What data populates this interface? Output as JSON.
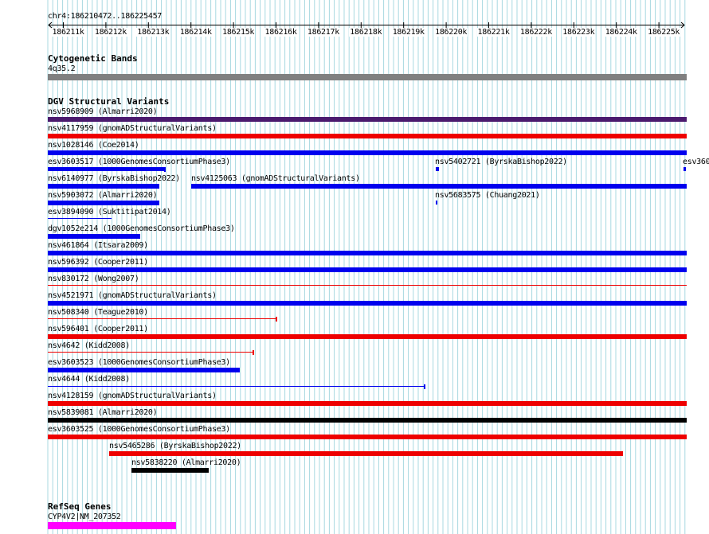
{
  "colors": {
    "grid": "#a8d8e0",
    "blue": "#0000ee",
    "red": "#ee0000",
    "purple": "#4b1a6e",
    "black": "#000000",
    "gray": "#808080",
    "magenta": "#ff00ff"
  },
  "ruler": {
    "location": "chr4:186210472..186225457",
    "ticks": [
      "186211k",
      "186212k",
      "186213k",
      "186214k",
      "186215k",
      "186216k",
      "186217k",
      "186218k",
      "186219k",
      "186220k",
      "186221k",
      "186222k",
      "186223k",
      "186224k",
      "186225k"
    ]
  },
  "cytobands": {
    "title": "Cytogenetic Bands",
    "band": "4q35.2"
  },
  "dgv": {
    "title": "DGV Structural Variants"
  },
  "refseq": {
    "title": "RefSeq Genes",
    "gene": "CYP4V2|NM_207352"
  },
  "features": [
    {
      "label": "nsv5968909 (Almarri2020)",
      "color": "purple"
    },
    {
      "label": "nsv4117959 (gnomADStructuralVariants)",
      "color": "red"
    },
    {
      "label": "nsv1028146 (Coe2014)",
      "color": "blue"
    },
    {
      "label": "esv3603517 (1000GenomesConsortiumPhase3)",
      "color": "blue"
    },
    {
      "label": "nsv5402721 (ByrskaBishop2022)",
      "color": "blue"
    },
    {
      "label": "esv360",
      "color": "blue"
    },
    {
      "label": "nsv6140977 (ByrskaBishop2022)",
      "color": "blue"
    },
    {
      "label": "nsv4125063 (gnomADStructuralVariants)",
      "color": "blue"
    },
    {
      "label": "nsv5903072 (Almarri2020)",
      "color": "blue"
    },
    {
      "label": "nsv5683575 (Chuang2021)",
      "color": "blue"
    },
    {
      "label": "esv3894090 (Suktitipat2014)",
      "color": "blue"
    },
    {
      "label": "dgv1052e214 (1000GenomesConsortiumPhase3)",
      "color": "blue"
    },
    {
      "label": "nsv461864 (Itsara2009)",
      "color": "blue"
    },
    {
      "label": "nsv596392 (Cooper2011)",
      "color": "blue"
    },
    {
      "label": "nsv830172 (Wong2007)",
      "color": "red"
    },
    {
      "label": "nsv4521971 (gnomADStructuralVariants)",
      "color": "blue"
    },
    {
      "label": "nsv508340 (Teague2010)",
      "color": "red"
    },
    {
      "label": "nsv596401 (Cooper2011)",
      "color": "red"
    },
    {
      "label": "nsv4642 (Kidd2008)",
      "color": "red"
    },
    {
      "label": "esv3603523 (1000GenomesConsortiumPhase3)",
      "color": "blue"
    },
    {
      "label": "nsv4644 (Kidd2008)",
      "color": "blue"
    },
    {
      "label": "nsv4128159 (gnomADStructuralVariants)",
      "color": "red"
    },
    {
      "label": "nsv5839081 (Almarri2020)",
      "color": "black"
    },
    {
      "label": "esv3603525 (1000GenomesConsortiumPhase3)",
      "color": "red"
    },
    {
      "label": "nsv5465286 (ByrskaBishop2022)",
      "color": "red"
    },
    {
      "label": "nsv5838220 (Almarri2020)",
      "color": "black"
    }
  ]
}
